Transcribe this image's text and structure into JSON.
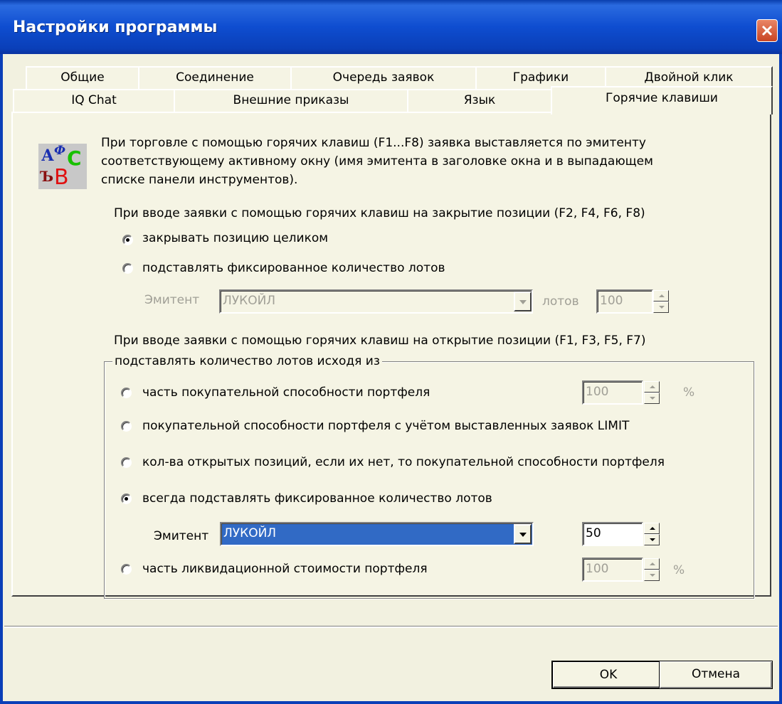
{
  "window": {
    "title": "Настройки программы"
  },
  "tabs_row1": [
    "Общие",
    "Соединение",
    "Очередь заявок",
    "Графики",
    "Двойной клик"
  ],
  "tabs_row2": [
    "IQ Chat",
    "Внешние приказы",
    "Язык",
    "Горячие клавиши"
  ],
  "active_tab": "Горячие клавиши",
  "info": {
    "line1": "При торговле с помощью горячих клавиш (F1...F8) заявка выставляется по эмитенту",
    "line2": "соответствующему активному окну (имя эмитента в заголовке окна и в выпадающем",
    "line3": "списке панели инструментов).",
    "icon_letters": [
      "А",
      "Ф",
      "С",
      "Ъ",
      "В"
    ]
  },
  "close_section": {
    "heading": "При вводе заявки с помощью горячих клавиш на закрытие позиции (F2, F4, F6, F8)",
    "option1": "закрывать позицию целиком",
    "option2": "подставлять фиксированное количество лотов",
    "emitent_label": "Эмитент",
    "emitent_value": "ЛУКОЙЛ",
    "lots_label": "лотов",
    "lots_value": "100",
    "selected": "option1"
  },
  "open_section": {
    "heading": "При вводе заявки с помощью горячих клавиш на открытие позиции (F1, F3, F5, F7)",
    "group_title": "подставлять количество лотов исходя из",
    "opt_part_buying": "часть покупательной способности портфеля",
    "opt_part_buying_value": "100",
    "opt_part_buying_unit": "%",
    "opt_buying_limit": "покупательной способности портфеля с учётом выставленных заявок LIMIT",
    "opt_open_positions": "кол-ва открытых позиций, если их нет, то покупательной способности портфеля",
    "opt_fixed": "всегда подставлять фиксированное количество лотов",
    "emitent_label": "Эмитент",
    "emitent_value": "ЛУКОЙЛ",
    "fixed_lots_value": "50",
    "opt_liquidation": "часть ликвидационной стоимости портфеля",
    "opt_liquidation_value": "100",
    "opt_liquidation_unit": "%",
    "selected": "opt_fixed"
  },
  "buttons": {
    "ok": "OK",
    "cancel": "Отмена"
  },
  "colors": {
    "titlebar": "#0e4dd0",
    "dialog_bg": "#f5f4e4",
    "selection": "#316ac5"
  }
}
